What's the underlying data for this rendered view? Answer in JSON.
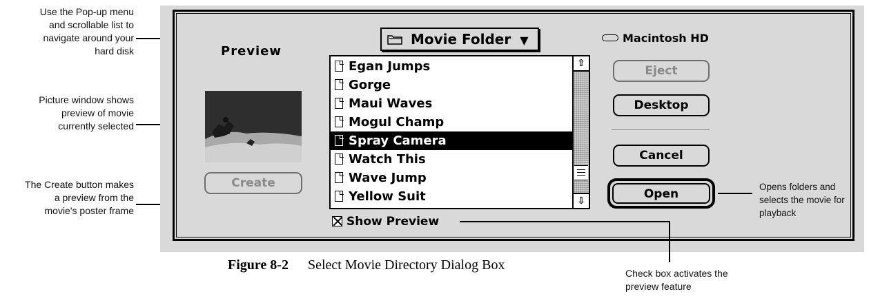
{
  "annotations": {
    "popup_note": [
      "Use the Pop-up menu",
      "and scrollable list to",
      "navigate around your",
      "hard disk"
    ],
    "picture_note": [
      "Picture window shows",
      "preview of movie",
      "currently selected"
    ],
    "create_note": [
      "The Create button makes",
      "a preview from the",
      "movie's poster frame"
    ],
    "open_note": [
      "Opens folders and",
      "selects the movie for",
      "playback"
    ],
    "checkbox_note": [
      "Check box activates the",
      "preview feature"
    ]
  },
  "dialog": {
    "preview_label": "Preview",
    "create_button": "Create",
    "folder_popup": "Movie Folder",
    "disk_name": "Macintosh HD",
    "files": [
      {
        "name": "Egan Jumps",
        "selected": false
      },
      {
        "name": "Gorge",
        "selected": false
      },
      {
        "name": "Maui Waves",
        "selected": false
      },
      {
        "name": "Mogul Champ",
        "selected": false
      },
      {
        "name": "Spray Camera",
        "selected": true
      },
      {
        "name": "Watch This",
        "selected": false
      },
      {
        "name": "Wave Jump",
        "selected": false
      },
      {
        "name": "Yellow Suit",
        "selected": false
      }
    ],
    "buttons": {
      "eject": "Eject",
      "desktop": "Desktop",
      "cancel": "Cancel",
      "open": "Open"
    },
    "show_preview_label": "Show Preview",
    "show_preview_checked": true
  },
  "caption": {
    "figure_number": "Figure 8-2",
    "title": "Select Movie Directory Dialog Box"
  },
  "colors": {
    "dialog_bg": "#d9d9d9",
    "selection": "#000000"
  }
}
